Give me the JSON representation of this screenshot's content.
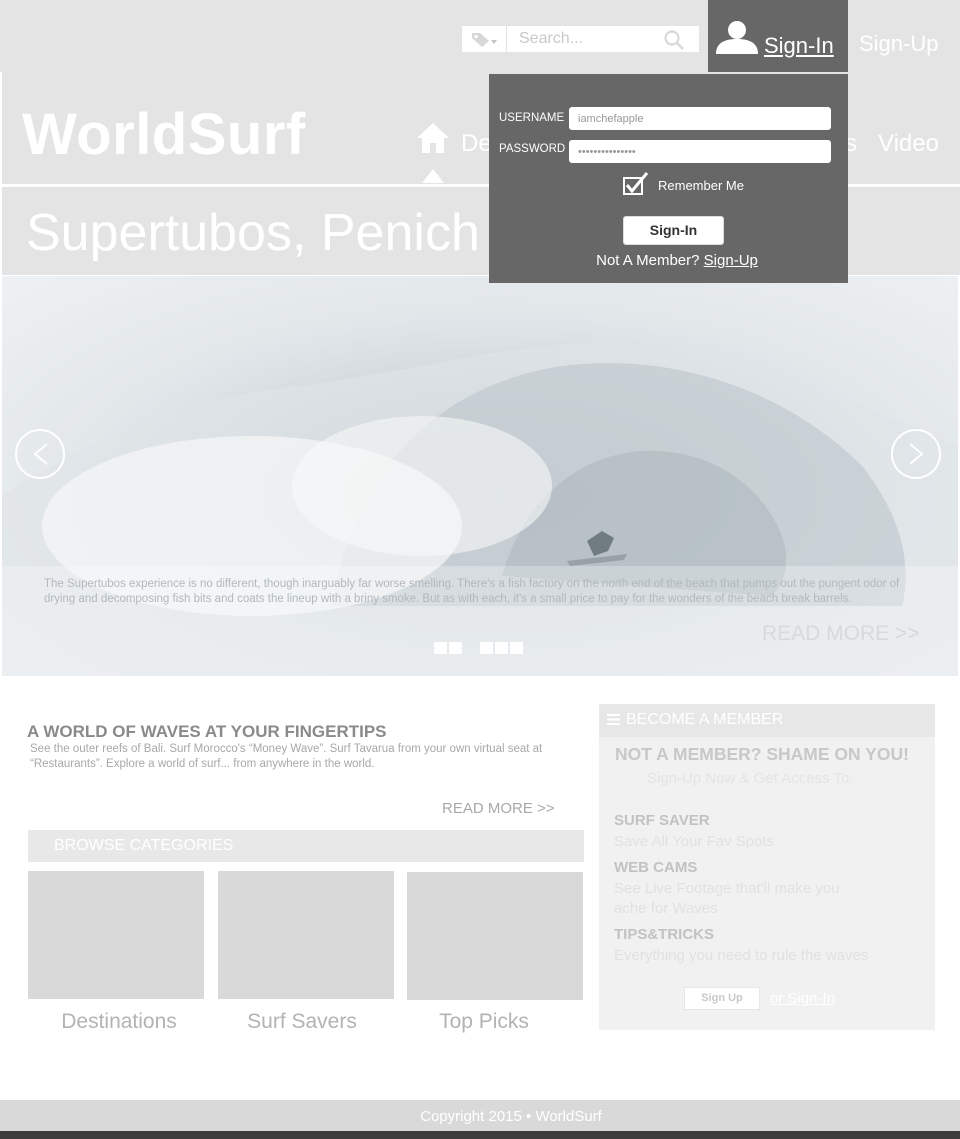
{
  "topbar": {
    "search_placeholder": "Search...",
    "signin_label": "Sign-In",
    "signup_label": "Sign-Up"
  },
  "header": {
    "logo": "WorldSurf",
    "nav": [
      {
        "label": "De"
      },
      {
        "label": "s"
      },
      {
        "label": "Video"
      }
    ]
  },
  "page_title": "Supertubos, Penich",
  "hero": {
    "caption": "The Supertubos experience is no different, though inarguably far worse smelling. There's a fish factory on the north end of the beach that pumps out the pungent odor of drying and decomposing fish bits and coats the lineup with a briny smoke. But as with each, it's a small price to pay for the wonders of the beach break barrels.",
    "read_more": "READ MORE >>",
    "slide_count": 5,
    "active_slide": 2
  },
  "main": {
    "heading": "A WORLD OF WAVES AT YOUR FINGERTIPS",
    "description": "See the outer reefs of Bali. Surf Morocco's “Money Wave”. Surf Tavarua from your own virtual seat at “Restaurants”. Explore a world of surf... from anywhere in the world.",
    "read_more": "READ MORE >>",
    "browse_label": "BROWSE CATEGORIES",
    "categories": [
      {
        "label": "Destinations"
      },
      {
        "label": "Surf Savers"
      },
      {
        "label": "Top Picks"
      }
    ]
  },
  "member": {
    "title": "BECOME A MEMBER",
    "shame": "NOT A MEMBER? SHAME ON YOU!",
    "sub": "Sign-Up Now & Get Access To:",
    "features": [
      {
        "title": "SURF SAVER",
        "desc": "Save All Your Fav Spots"
      },
      {
        "title": "WEB CAMS",
        "desc": "See Live Footage that'll make you ache for Waves"
      },
      {
        "title": "TIPS&TRICKS",
        "desc": "Everything you need to rule the waves"
      }
    ],
    "signup_button": "Sign Up",
    "or_signin": "or Sign-In"
  },
  "login": {
    "username_label": "USERNAME",
    "username_value": "iamchefapple",
    "password_label": "PASSWORD",
    "password_value": "•••••••••••••••",
    "remember_label": "Remember Me",
    "remember_checked": true,
    "signin_button": "Sign-In",
    "not_member": "Not A Member?",
    "signup_link": "Sign-Up"
  },
  "footer": {
    "copyright": "Copyright 2015 • WorldSurf"
  },
  "colors": {
    "panel_dark": "#676767",
    "band_gray": "#e4e4e4",
    "placeholder_gray": "#dad9da"
  }
}
